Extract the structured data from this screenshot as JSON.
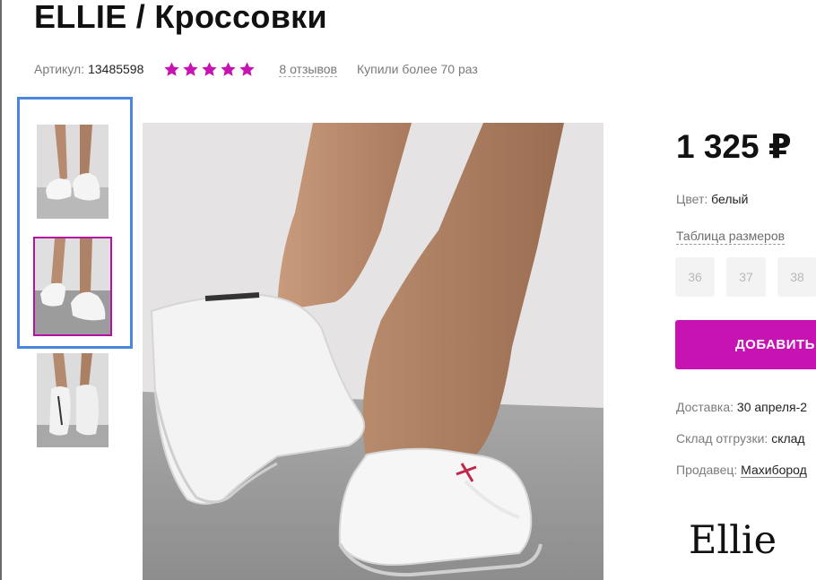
{
  "product": {
    "title": "ELLIE / Кроссовки",
    "sku_label": "Артикул:",
    "sku_value": "13485598",
    "rating_stars": 5,
    "reviews_link": "8 отзывов",
    "bought_text": "Купили более 70 раз"
  },
  "gallery": {
    "thumbnails": [
      "thumb-front-walking",
      "thumb-side-walking",
      "thumb-back-heels"
    ],
    "selected_index": 1
  },
  "buy_box": {
    "price": "1 325 ₽",
    "color_label": "Цвет:",
    "color_value": "белый",
    "size_table_link": "Таблица размеров",
    "sizes": [
      "36",
      "37",
      "38"
    ],
    "add_button": "ДОБАВИТЬ",
    "delivery_label": "Доставка:",
    "delivery_value": "30 апреля-2",
    "warehouse_label": "Склад отгрузки:",
    "warehouse_value": "склад",
    "seller_label": "Продавец:",
    "seller_value": "Махибород"
  },
  "brand": {
    "logo_text": "Ellie"
  },
  "colors": {
    "accent": "#c813b3",
    "focus_frame": "#4a86e0"
  }
}
